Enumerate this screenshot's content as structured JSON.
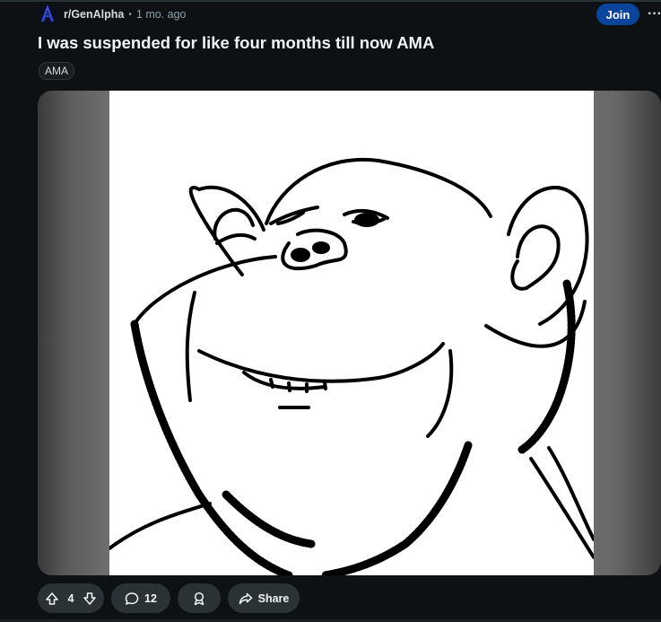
{
  "post": {
    "subreddit": "r/GenAlpha",
    "separator": "•",
    "time_ago": "1 mo. ago",
    "join_label": "Join",
    "more_label": "···",
    "title": "I was suspended for like four months till now AMA",
    "flair": "AMA"
  },
  "actions": {
    "votes": "4",
    "comments": "12",
    "share_label": "Share"
  },
  "icons": {
    "avatar": "subreddit-avatar-icon",
    "upvote": "arrow-up-icon",
    "downvote": "arrow-down-icon",
    "comment": "comment-bubble-icon",
    "award": "award-icon",
    "share": "share-arrow-icon"
  },
  "colors": {
    "background": "#0e1113",
    "join_button": "#0a449b",
    "pill": "#2a3236",
    "muted_text": "#8ba2ad"
  }
}
